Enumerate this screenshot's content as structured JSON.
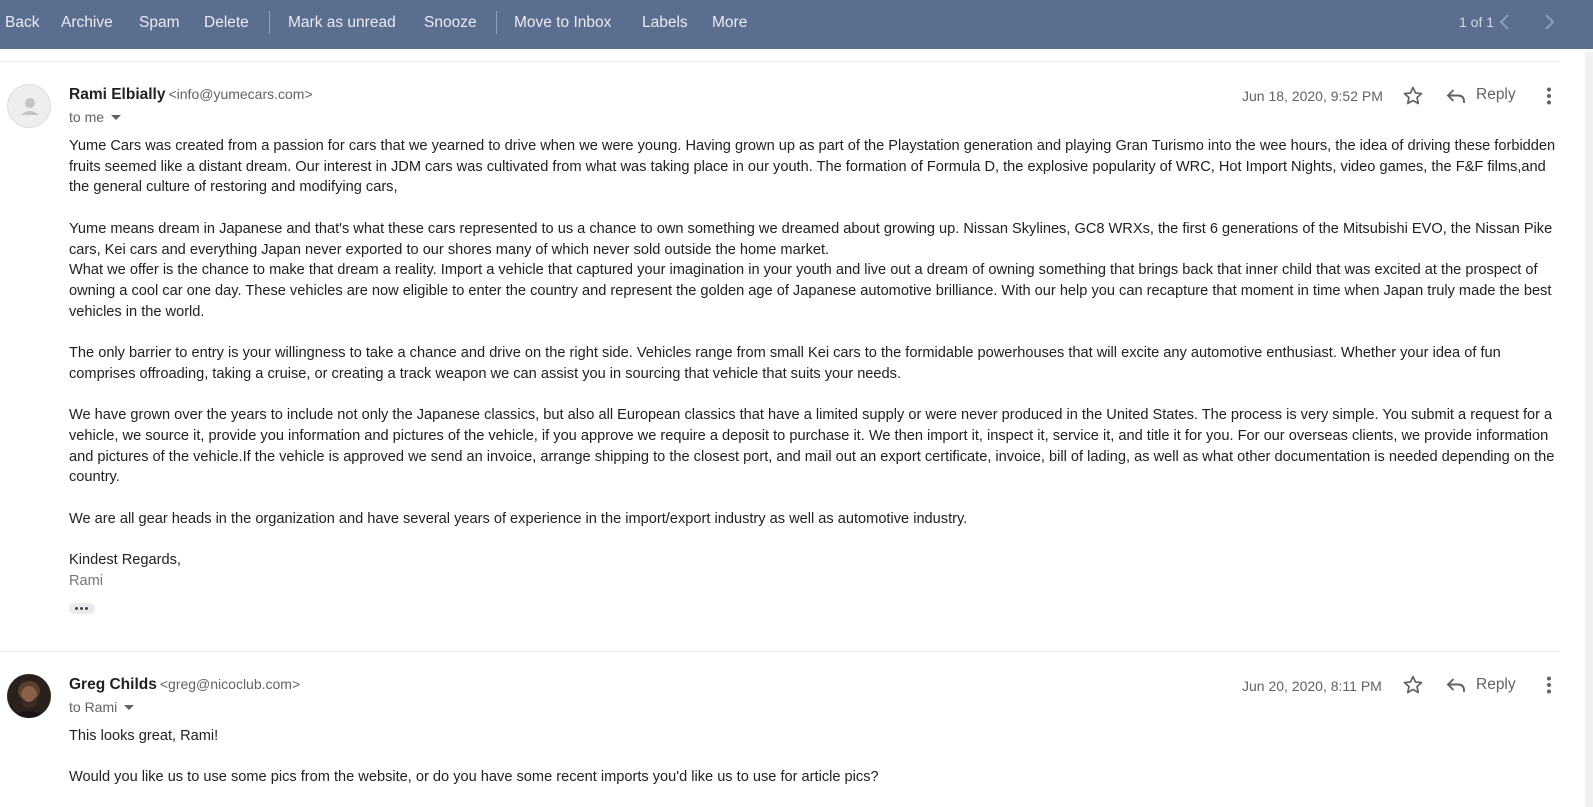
{
  "toolbar": {
    "items": [
      "Back",
      "Archive",
      "Spam",
      "Delete",
      "Mark as unread",
      "Snooze",
      "Move to Inbox",
      "Labels",
      "More"
    ],
    "pager": "1 of 1",
    "prev_icon": "chevron-left-icon",
    "next_icon": "chevron-right-icon"
  },
  "messages": [
    {
      "sender_name": "Rami Elbially",
      "sender_email": "<info@yumecars.com>",
      "recipient": "to me",
      "date": "Jun 18, 2020, 9:52 PM",
      "reply_label": "Reply",
      "icons": [
        "star-icon",
        "reply-icon",
        "more-vert-icon"
      ],
      "paragraphs": [
        "Yume Cars was created from a passion for cars that we yearned to drive when we were young. Having grown up as part of the Playstation generation and playing Gran Turismo into the wee hours, the idea of driving these forbidden fruits seemed like a distant dream. Our interest in JDM cars was cultivated from what was taking place in our youth. The formation of Formula D, the explosive popularity of WRC, Hot Import Nights, video games,  the F&F films,and the general culture of restoring and modifying cars,",
        "Yume means dream in Japanese and that's what these cars represented to us a chance to own something we dreamed about growing up. Nissan Skylines, GC8 WRXs, the first 6 generations of the Mitsubishi EVO, the Nissan Pike cars, Kei cars and everything Japan never exported to our shores many of which never sold outside the home market.",
        "What we offer is the chance to make that dream a reality. Import a vehicle that captured your imagination in your youth and live out a dream of owning something that brings back that inner child that was excited at the prospect of owning a cool car one day. These vehicles are now eligible to enter the country and represent the golden age of Japanese automotive brilliance. With our help you can recapture that moment in time when Japan truly made the best vehicles in the world.",
        "The only barrier to entry is your willingness to take a chance and drive on the right side. Vehicles range from small Kei cars to the formidable powerhouses that will excite any automotive enthusiast. Whether your idea of fun comprises offroading, taking a cruise, or creating a track weapon we can assist you in sourcing that vehicle that suits your needs.",
        "We have grown over the years to include not only the Japanese classics, but also all European classics that have a limited supply or were never produced in the United States. The process is very simple. You submit a request for a vehicle, we source it, provide you information and pictures of the vehicle, if you approve we require a deposit to purchase it. We then import it, inspect it, service it, and title it for you. For our overseas clients, we provide information and pictures of the vehicle.If the vehicle is approved we send an invoice, arrange shipping to the closest port, and mail out an export certificate, invoice, bill of lading, as well as what other documentation is needed depending on the country.",
        "We are all gear heads in the organization and have several years of experience in the import/export industry as well as automotive industry."
      ],
      "signoff": "Kindest Regards,",
      "signature": "Rami"
    },
    {
      "sender_name": "Greg Childs",
      "sender_email": "<greg@nicoclub.com>",
      "recipient": "to Rami",
      "date": "Jun 20, 2020, 8:11 PM",
      "reply_label": "Reply",
      "icons": [
        "star-icon",
        "reply-icon",
        "more-vert-icon"
      ],
      "paragraphs": [
        "This looks great, Rami!",
        "Would you like us to use some pics from the website, or do you have some recent imports you'd like us to use for article pics?"
      ]
    }
  ]
}
